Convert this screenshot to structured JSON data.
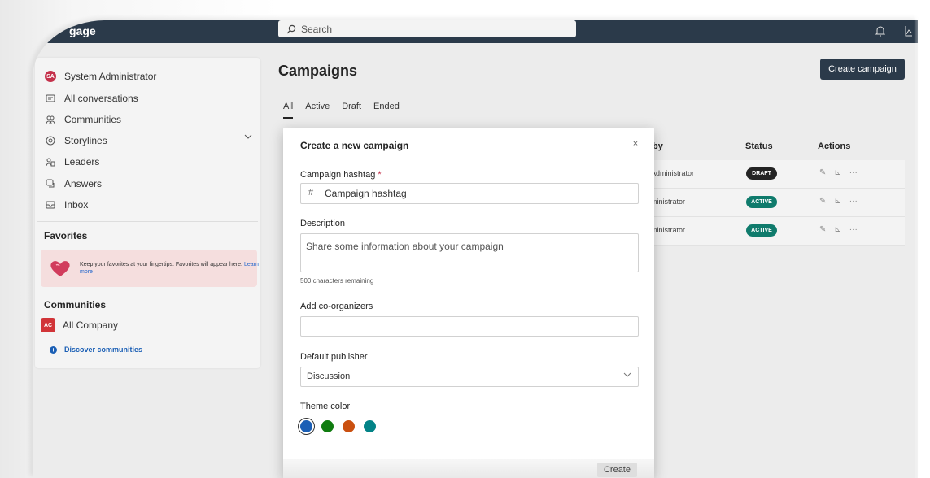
{
  "app": {
    "brand": "gage"
  },
  "search": {
    "placeholder": "Search"
  },
  "sidebar": {
    "user": {
      "initials": "SA",
      "name": "System Administrator"
    },
    "items": [
      {
        "label": "All conversations",
        "icon": "conversations-icon"
      },
      {
        "label": "Communities",
        "icon": "communities-icon"
      },
      {
        "label": "Storylines",
        "icon": "storylines-icon"
      },
      {
        "label": "Leaders",
        "icon": "leaders-icon"
      },
      {
        "label": "Answers",
        "icon": "answers-icon"
      },
      {
        "label": "Inbox",
        "icon": "inbox-icon"
      }
    ],
    "favorites_title": "Favorites",
    "favorites_hint": "Keep your favorites at your fingertips. Favorites will appear here.",
    "favorites_link": "Learn more",
    "communities_title": "Communities",
    "community": {
      "initials": "AC",
      "name": "All Company"
    },
    "discover": "Discover communities"
  },
  "main": {
    "title": "Campaigns",
    "create_button": "Create campaign",
    "tabs": [
      "All",
      "Active",
      "Draft",
      "Ended"
    ],
    "columns": {
      "by": "by",
      "status": "Status",
      "actions": "Actions"
    },
    "rows": [
      {
        "by": "Administrator",
        "status": "DRAFT"
      },
      {
        "by": "ministrator",
        "status": "ACTIVE"
      },
      {
        "by": "ministrator",
        "status": "ACTIVE"
      }
    ]
  },
  "modal": {
    "title": "Create a new campaign",
    "close": "×",
    "hashtag_label": "Campaign hashtag",
    "required_mark": "*",
    "hashtag_prefix": "#",
    "hashtag_placeholder": "Campaign hashtag",
    "description_label": "Description",
    "description_placeholder": "Share some information about your campaign",
    "chars_remaining": "500 characters remaining",
    "coorganizers_label": "Add co-organizers",
    "publisher_label": "Default publisher",
    "publisher_value": "Discussion",
    "theme_label": "Theme color",
    "theme_colors": [
      "#1b5fb5",
      "#107c10",
      "#ca5010",
      "#038387"
    ],
    "create_button": "Create"
  }
}
